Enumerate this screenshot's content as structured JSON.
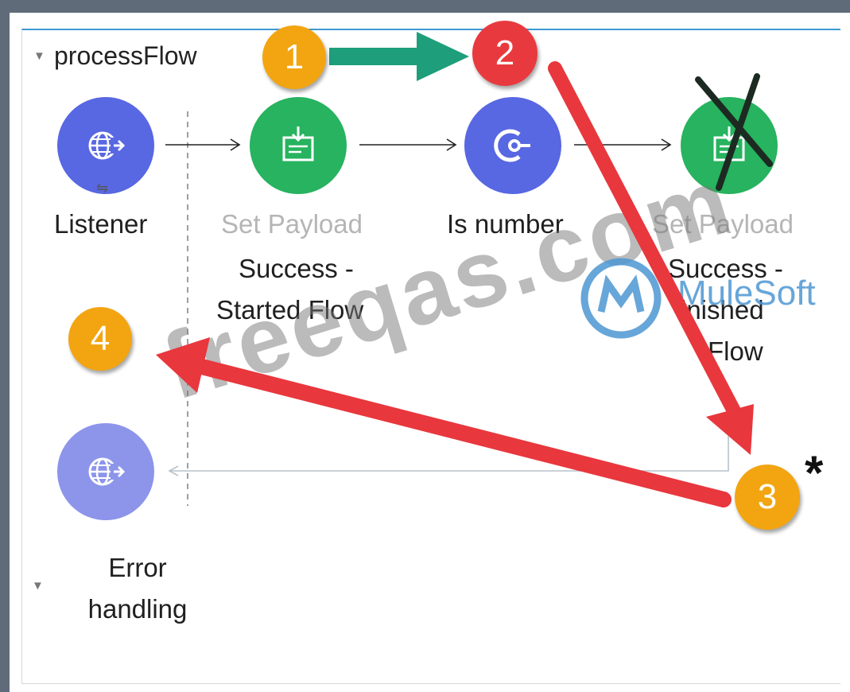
{
  "flow": {
    "title": "processFlow",
    "error_section": "Error handling"
  },
  "nodes": {
    "listener": {
      "label": "Listener",
      "icon": "globe-listener-icon",
      "color": "#5867e2"
    },
    "set_payload_1": {
      "type_label": "Set Payload",
      "label_line1": "Success -",
      "label_line2": "Started Flow",
      "icon": "set-payload-icon",
      "color": "#27b35f"
    },
    "is_number": {
      "label": "Is number",
      "icon": "validation-icon",
      "color": "#5867e2"
    },
    "set_payload_2": {
      "type_label": "Set Payload",
      "label_line1": "Success -",
      "label_line2": "inished",
      "label_line3": "Flow",
      "icon": "set-payload-icon",
      "color": "#27b35f"
    },
    "error_listener": {
      "icon": "globe-listener-icon",
      "color": "#8c95ea"
    }
  },
  "annotations": {
    "badge_1": "1",
    "badge_2": "2",
    "badge_3": "3",
    "badge_4": "4",
    "star": "*",
    "badge_orange": "#f2a511",
    "badge_red": "#e83a3e",
    "arrow_green": "#1e9e7a",
    "arrow_red": "#e8373d"
  },
  "watermark": {
    "text": "freeqas.com",
    "brand": "MuleSoft"
  }
}
